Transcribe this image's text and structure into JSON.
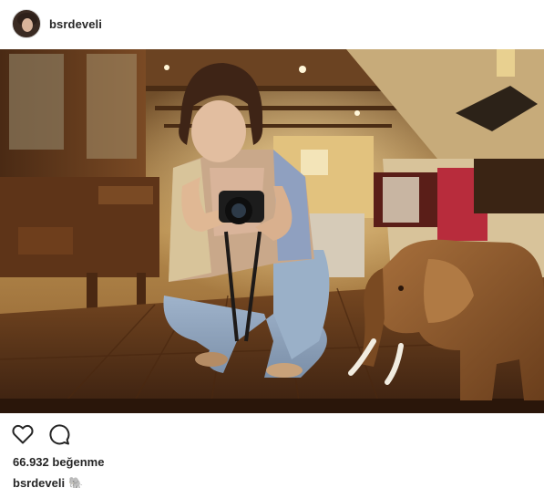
{
  "post": {
    "username": "bsrdeveli",
    "likes_text": "66.932 beğenme",
    "caption_username": "bsrdeveli",
    "caption_emoji": "🐘"
  },
  "icons": {
    "like": "heart-icon",
    "comment": "comment-icon"
  },
  "colors": {
    "text": "#262626",
    "border": "#dbdbdb",
    "background": "#ffffff"
  }
}
